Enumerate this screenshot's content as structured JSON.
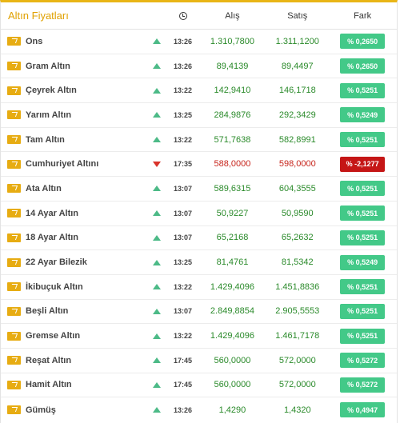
{
  "header": {
    "title": "Altın Fiyatları",
    "clock_icon": "clock-icon",
    "buy": "Alış",
    "sell": "Satış",
    "diff": "Fark"
  },
  "colors": {
    "accent": "#e9b516",
    "up": "#43c988",
    "down": "#c51616"
  },
  "rows": [
    {
      "name": "Ons",
      "trend": "up",
      "time": "13:26",
      "buy": "1.310,7800",
      "sell": "1.311,1200",
      "diff": "% 0,2650"
    },
    {
      "name": "Gram Altın",
      "trend": "up",
      "time": "13:26",
      "buy": "89,4139",
      "sell": "89,4497",
      "diff": "% 0,2650"
    },
    {
      "name": "Çeyrek Altın",
      "trend": "up",
      "time": "13:22",
      "buy": "142,9410",
      "sell": "146,1718",
      "diff": "% 0,5251"
    },
    {
      "name": "Yarım Altın",
      "trend": "up",
      "time": "13:25",
      "buy": "284,9876",
      "sell": "292,3429",
      "diff": "% 0,5249"
    },
    {
      "name": "Tam Altın",
      "trend": "up",
      "time": "13:22",
      "buy": "571,7638",
      "sell": "582,8991",
      "diff": "% 0,5251"
    },
    {
      "name": "Cumhuriyet Altını",
      "trend": "down",
      "time": "17:35",
      "buy": "588,0000",
      "sell": "598,0000",
      "diff": "% -2,1277"
    },
    {
      "name": "Ata Altın",
      "trend": "up",
      "time": "13:07",
      "buy": "589,6315",
      "sell": "604,3555",
      "diff": "% 0,5251"
    },
    {
      "name": "14 Ayar Altın",
      "trend": "up",
      "time": "13:07",
      "buy": "50,9227",
      "sell": "50,9590",
      "diff": "% 0,5251"
    },
    {
      "name": "18 Ayar Altın",
      "trend": "up",
      "time": "13:07",
      "buy": "65,2168",
      "sell": "65,2632",
      "diff": "% 0,5251"
    },
    {
      "name": "22 Ayar Bilezik",
      "trend": "up",
      "time": "13:25",
      "buy": "81,4761",
      "sell": "81,5342",
      "diff": "% 0,5249"
    },
    {
      "name": "İkibuçuk Altın",
      "trend": "up",
      "time": "13:22",
      "buy": "1.429,4096",
      "sell": "1.451,8836",
      "diff": "% 0,5251"
    },
    {
      "name": "Beşli Altın",
      "trend": "up",
      "time": "13:07",
      "buy": "2.849,8854",
      "sell": "2.905,5553",
      "diff": "% 0,5251"
    },
    {
      "name": "Gremse Altın",
      "trend": "up",
      "time": "13:22",
      "buy": "1.429,4096",
      "sell": "1.461,7178",
      "diff": "% 0,5251"
    },
    {
      "name": "Reşat Altın",
      "trend": "up",
      "time": "17:45",
      "buy": "560,0000",
      "sell": "572,0000",
      "diff": "% 0,5272"
    },
    {
      "name": "Hamit Altın",
      "trend": "up",
      "time": "17:45",
      "buy": "560,0000",
      "sell": "572,0000",
      "diff": "% 0,5272"
    },
    {
      "name": "Gümüş",
      "trend": "up",
      "time": "13:26",
      "buy": "1,4290",
      "sell": "1,4320",
      "diff": "% 0,4947"
    }
  ]
}
